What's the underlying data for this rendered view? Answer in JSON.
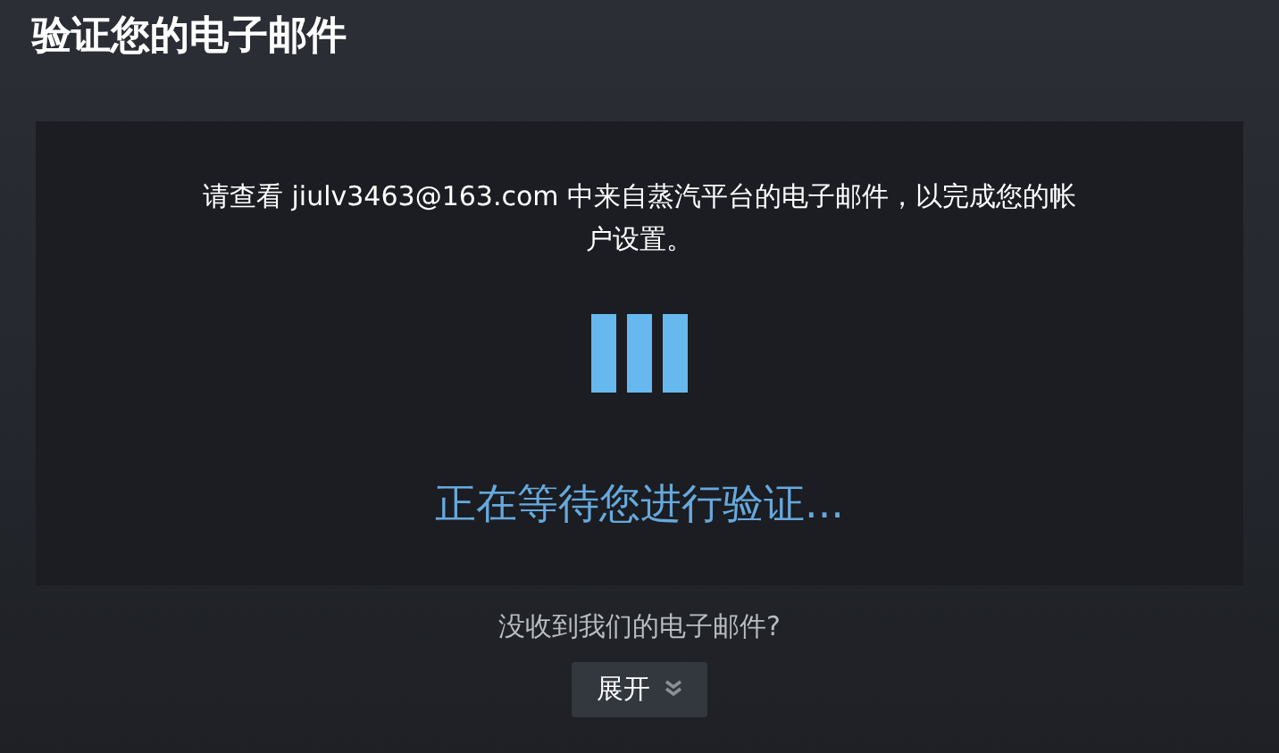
{
  "title": "验证您的电子邮件",
  "panel": {
    "message": "请查看 jiulv3463@163.com 中来自蒸汽平台的电子邮件，以完成您的帐户设置。",
    "status": "正在等待您进行验证..."
  },
  "help": {
    "question": "没收到我们的电子邮件?",
    "button": "展开"
  }
}
